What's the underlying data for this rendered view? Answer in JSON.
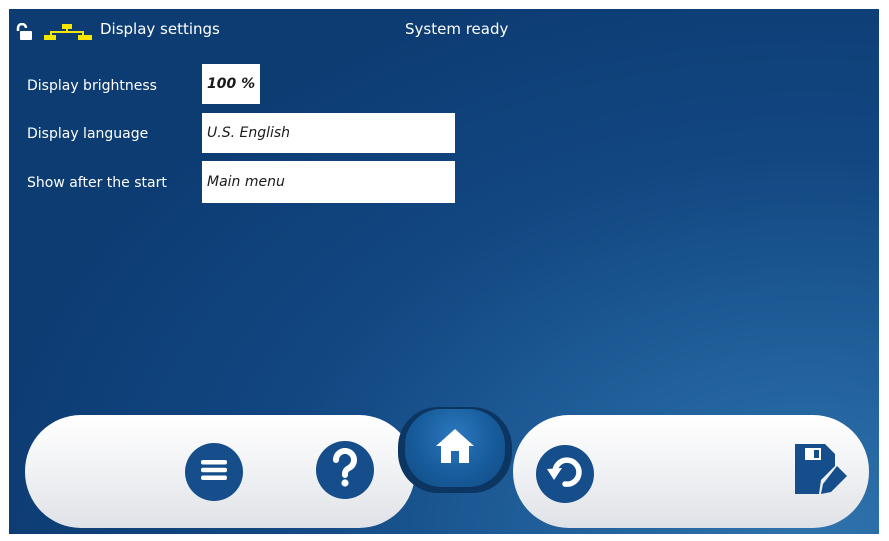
{
  "header": {
    "lock_icon": "unlocked-padlock-icon",
    "network_icon": "network-topology-icon",
    "title": "Display settings",
    "status": "System ready"
  },
  "settings": [
    {
      "label": "Display brightness",
      "value": "100 %"
    },
    {
      "label": "Display language",
      "value": "U.S. English"
    },
    {
      "label": "Show after the start",
      "value": "Main menu"
    }
  ],
  "toolbar": {
    "buttons": [
      "menu-icon",
      "help-icon",
      "home-icon",
      "undo-icon",
      "save-edit-icon"
    ]
  },
  "colors": {
    "background": "#124782",
    "accent_yellow": "#f4e600",
    "button_blue": "#154e8a",
    "bar": "#eef0f3"
  }
}
